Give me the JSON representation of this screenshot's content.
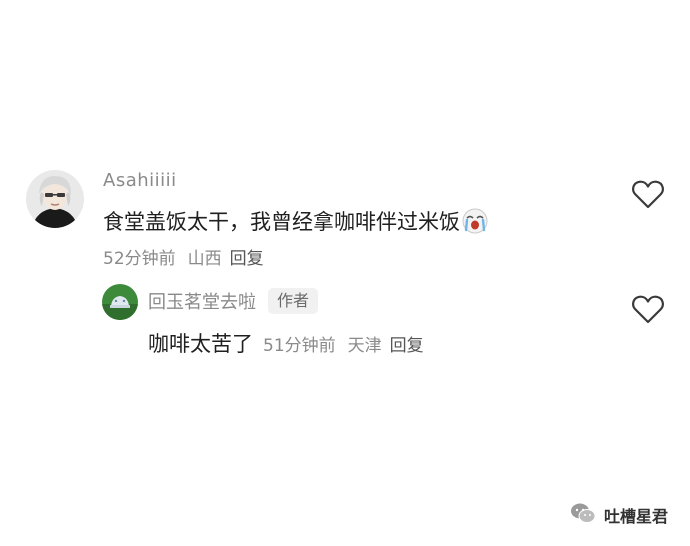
{
  "comments": [
    {
      "username": "Asahiiiii",
      "text": "食堂盖饭太干，我曾经拿咖啡伴过米饭",
      "emoji": "crying-face",
      "time": "52分钟前",
      "location": "山西",
      "reply_label": "回复"
    }
  ],
  "replies": [
    {
      "username": "回玉茗堂去啦",
      "badge": "作者",
      "text": "咖啡太苦了",
      "time": "51分钟前",
      "location": "天津",
      "reply_label": "回复"
    }
  ],
  "watermark": {
    "text": "吐槽星君",
    "icon": "wechat-icon"
  },
  "colors": {
    "text_primary": "#1f1f1f",
    "text_secondary": "#8a8a8a",
    "badge_bg": "#f1f1f1"
  }
}
